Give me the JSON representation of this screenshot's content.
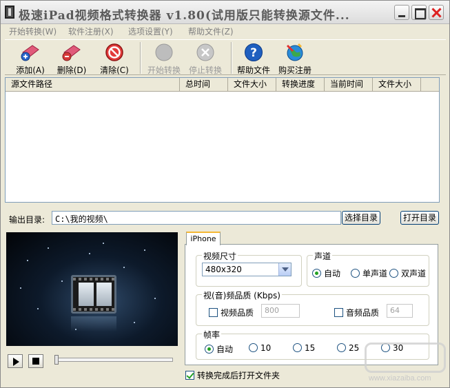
{
  "window": {
    "title": "极速iPad视频格式转换器 v1.80(试用版只能转换源文件..."
  },
  "menu": [
    "开始转换(W)",
    "软件注册(X)",
    "选项设置(Y)",
    "帮助文件(Z)"
  ],
  "toolbar": {
    "add": "添加(A)",
    "delete": "删除(D)",
    "clear": "清除(C)",
    "start": "开始转换",
    "stop": "停止转换",
    "help": "帮助文件",
    "buy": "购买注册"
  },
  "filelist": {
    "columns": [
      "源文件路径",
      "总时间",
      "文件大小",
      "转换进度",
      "当前时间",
      "文件大小"
    ]
  },
  "output": {
    "label": "输出目录:",
    "path": "C:\\我的视频\\",
    "choose_button": "选择目录",
    "open_button": "打开目录"
  },
  "settings": {
    "tab": "iPhone",
    "video_size": {
      "title": "视频尺寸",
      "value": "480x320"
    },
    "channel": {
      "title": "声道",
      "options": [
        "自动",
        "单声道",
        "双声道"
      ],
      "selected": 0
    },
    "quality": {
      "title": "视(音)频品质 (Kbps)",
      "video_label": "视频品质",
      "video_value": "800",
      "audio_label": "音频品质",
      "audio_value": "64"
    },
    "framerate": {
      "title": "帧率",
      "options": [
        "自动",
        "10",
        "15",
        "25",
        "30"
      ],
      "selected": 0
    }
  },
  "open_after": "转换完成后打开文件夹",
  "colors": {
    "accent": "#f5b733",
    "radio_on": "#21a121",
    "help_blue": "#1f5fbf"
  },
  "watermark": "www.xiazaiba.com"
}
